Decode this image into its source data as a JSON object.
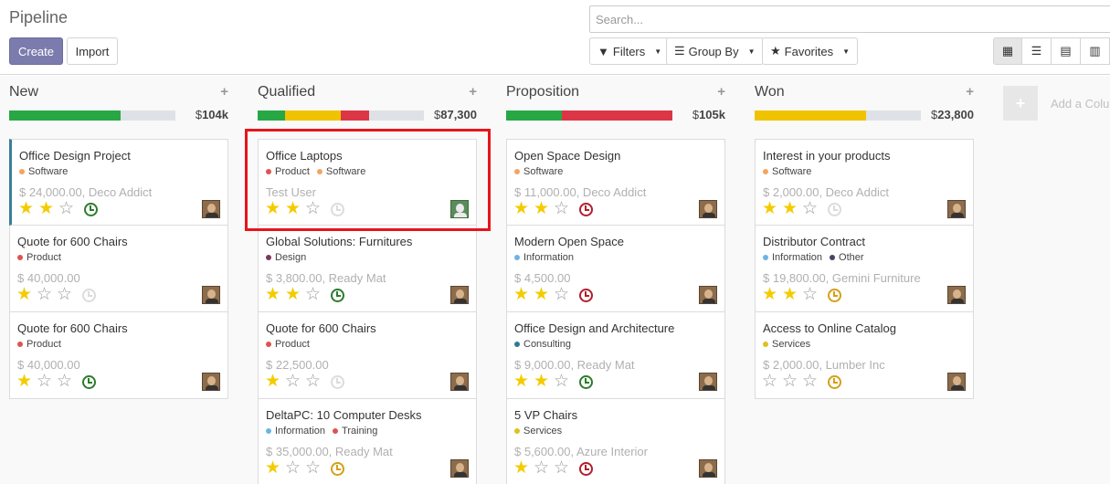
{
  "page_title": "Pipeline",
  "buttons": {
    "create": "Create",
    "import": "Import"
  },
  "search": {
    "placeholder": "Search..."
  },
  "filters": {
    "filters": "Filters",
    "group_by": "Group By",
    "favorites": "Favorites"
  },
  "view_switcher": [
    "kanban-icon",
    "list-icon",
    "calendar-icon",
    "pivot-icon"
  ],
  "add_column": {
    "plus": "+",
    "label": "Add a Colu"
  },
  "colors": {
    "primary": "#7c7bad",
    "green": "#28a745",
    "yellow": "#f0c300",
    "red": "#dc3545",
    "gray": "#dee2e6",
    "star": "#f3cc00",
    "highlight": "#e8141b"
  },
  "columns": [
    {
      "title": "New",
      "plus": "+",
      "currency": "$",
      "total": "104k",
      "progress": [
        {
          "fraction": 0.67,
          "color": "#28a745"
        }
      ],
      "cards": [
        {
          "name": "Office Design Project",
          "tags": [
            {
              "label": "Software",
              "color": "#f4a460"
            }
          ],
          "sub": "$ 24,000.00, Deco Addict",
          "stars": 2,
          "activity": "#2d7c2d",
          "avatar": "user",
          "highlight_left": true
        },
        {
          "name": "Quote for 600 Chairs",
          "tags": [
            {
              "label": "Product",
              "color": "#e05252"
            }
          ],
          "sub": "$ 40,000.00",
          "stars": 1,
          "activity": "#dcdcdc",
          "avatar": "user"
        },
        {
          "name": "Quote for 600 Chairs",
          "tags": [
            {
              "label": "Product",
              "color": "#e05252"
            }
          ],
          "sub": "$ 40,000.00",
          "stars": 1,
          "activity": "#2d7c2d",
          "avatar": "user"
        }
      ]
    },
    {
      "title": "Qualified",
      "plus": "+",
      "currency": "$",
      "total": "87,300",
      "progress": [
        {
          "fraction": 0.165,
          "color": "#28a745"
        },
        {
          "fraction": 0.335,
          "color": "#f0c300"
        },
        {
          "fraction": 0.17,
          "color": "#dc3545"
        }
      ],
      "cards": [
        {
          "name": "Office Laptops",
          "tags": [
            {
              "label": "Product",
              "color": "#e05252"
            },
            {
              "label": "Software",
              "color": "#f4a460"
            }
          ],
          "sub": "Test User",
          "stars": 2,
          "activity": "#dcdcdc",
          "avatar": "generic"
        },
        {
          "name": "Global Solutions: Furnitures",
          "tags": [
            {
              "label": "Design",
              "color": "#7a3a5a"
            }
          ],
          "sub": "$ 3,800.00, Ready Mat",
          "stars": 2,
          "activity": "#2d7c2d",
          "avatar": "user"
        },
        {
          "name": "Quote for 600 Chairs",
          "tags": [
            {
              "label": "Product",
              "color": "#e05252"
            }
          ],
          "sub": "$ 22,500.00",
          "stars": 1,
          "activity": "#dcdcdc",
          "avatar": "user"
        },
        {
          "name": "DeltaPC: 10 Computer Desks",
          "tags": [
            {
              "label": "Information",
              "color": "#6cb4e4"
            },
            {
              "label": "Training",
              "color": "#e05252"
            }
          ],
          "sub": "$ 35,000.00, Ready Mat",
          "stars": 1,
          "activity": "#d4a017",
          "avatar": "user"
        }
      ]
    },
    {
      "title": "Proposition",
      "plus": "+",
      "currency": "$",
      "total": "105k",
      "progress": [
        {
          "fraction": 0.335,
          "color": "#28a745"
        },
        {
          "fraction": 0.665,
          "color": "#dc3545"
        }
      ],
      "cards": [
        {
          "name": "Open Space Design",
          "tags": [
            {
              "label": "Software",
              "color": "#f4a460"
            }
          ],
          "sub": "$ 11,000.00, Deco Addict",
          "stars": 2,
          "activity": "#b0202c",
          "avatar": "user"
        },
        {
          "name": "Modern Open Space",
          "tags": [
            {
              "label": "Information",
              "color": "#6cb4e4"
            }
          ],
          "sub": "$ 4,500.00",
          "stars": 2,
          "activity": "#b0202c",
          "avatar": "user"
        },
        {
          "name": "Office Design and Architecture",
          "tags": [
            {
              "label": "Consulting",
              "color": "#2d7a96"
            }
          ],
          "sub": "$ 9,000.00, Ready Mat",
          "stars": 2,
          "activity": "#2d7c2d",
          "avatar": "user"
        },
        {
          "name": "5 VP Chairs",
          "tags": [
            {
              "label": "Services",
              "color": "#e0c020"
            }
          ],
          "sub": "$ 5,600.00, Azure Interior",
          "stars": 1,
          "activity": "#b0202c",
          "avatar": "user"
        }
      ]
    },
    {
      "title": "Won",
      "plus": "+",
      "currency": "$",
      "total": "23,800",
      "progress": [
        {
          "fraction": 0.67,
          "color": "#f0c300"
        }
      ],
      "cards": [
        {
          "name": "Interest in your products",
          "tags": [
            {
              "label": "Software",
              "color": "#f4a460"
            }
          ],
          "sub": "$ 2,000.00, Deco Addict",
          "stars": 2,
          "activity": "#dcdcdc",
          "avatar": "user"
        },
        {
          "name": "Distributor Contract",
          "tags": [
            {
              "label": "Information",
              "color": "#6cb4e4"
            },
            {
              "label": "Other",
              "color": "#444466"
            }
          ],
          "sub": "$ 19,800.00, Gemini Furniture",
          "stars": 2,
          "activity": "#d4a017",
          "avatar": "user"
        },
        {
          "name": "Access to Online Catalog",
          "tags": [
            {
              "label": "Services",
              "color": "#e0c020"
            }
          ],
          "sub": "$ 2,000.00, Lumber Inc",
          "stars": 0,
          "activity": "#d4a017",
          "avatar": "user"
        }
      ]
    }
  ]
}
